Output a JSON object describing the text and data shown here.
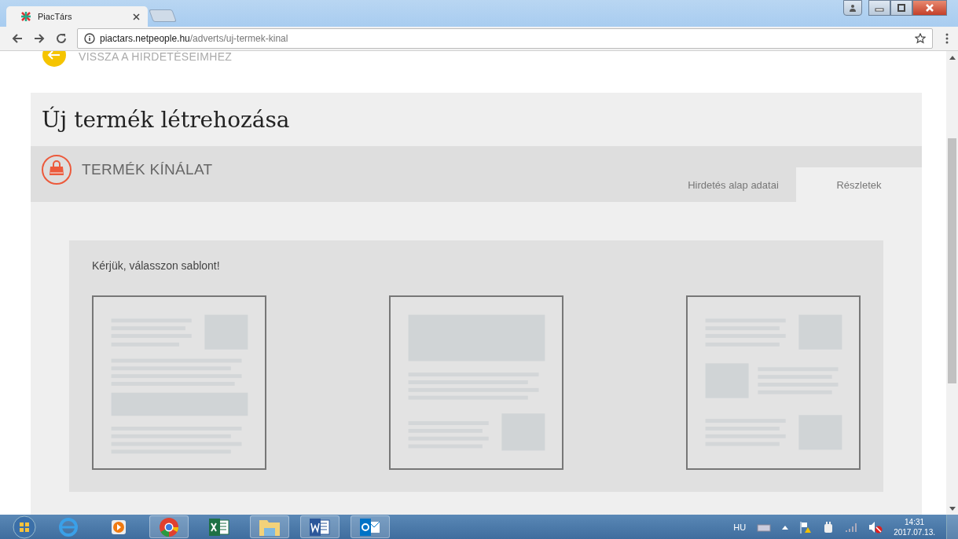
{
  "browser": {
    "tab_title": "PiacTárs",
    "url_host": "piactars.netpeople.hu",
    "url_path": "/adverts/uj-termek-kinal"
  },
  "back_link": "VISSZA A HIRDETÉSEIMHEZ",
  "page_title": "Új termék létrehozása",
  "section_title": "TERMÉK KÍNÁLAT",
  "tabs": [
    {
      "label": "Hirdetés alap adatai",
      "selected": false
    },
    {
      "label": "Részletek",
      "selected": true
    }
  ],
  "prompt": "Kérjük, válasszon sablont!",
  "templates": [
    {
      "kind": "stacked"
    },
    {
      "kind": "banner"
    },
    {
      "kind": "alternating"
    }
  ],
  "taskbar": {
    "language": "HU",
    "time": "14:31",
    "date": "2017.07.13."
  }
}
